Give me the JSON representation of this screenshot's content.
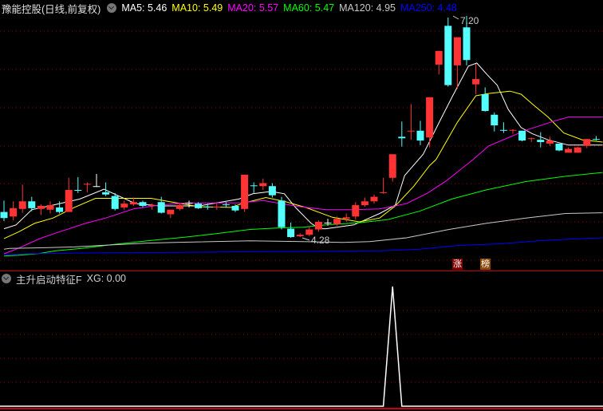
{
  "header": {
    "title": "豫能控股(日线,前复权)",
    "ma": [
      {
        "label": "MA5: 5.46",
        "color": "#ffffff"
      },
      {
        "label": "MA10: 5.49",
        "color": "#ffff00"
      },
      {
        "label": "MA20: 5.57",
        "color": "#ff00ff"
      },
      {
        "label": "MA60: 5.47",
        "color": "#00ff00"
      },
      {
        "label": "MA120: 4.95",
        "color": "#c8c8c8"
      },
      {
        "label": "MA250: 4.48",
        "color": "#0000ff"
      }
    ]
  },
  "annotations": {
    "high_label": "7.20",
    "low_label": "4.28"
  },
  "badges": [
    {
      "text": "涨",
      "color": "#800000",
      "index": 49
    },
    {
      "text": "榜",
      "color": "#8b4a0a",
      "index": 52
    }
  ],
  "indicator": {
    "title": "主升启动特征F",
    "value_label": "XG: 0.00"
  },
  "colors": {
    "up": "#ff3333",
    "down": "#54ffff",
    "doji": "#ffffff",
    "grid": "#8b0000",
    "divider": "#cc0000"
  },
  "chart_data": {
    "type": "candlestick",
    "ylim": [
      4.0,
      7.3
    ],
    "candles_ohlc": [
      [
        4.62,
        4.77,
        4.5,
        4.54
      ],
      [
        4.56,
        4.76,
        4.51,
        4.67
      ],
      [
        4.66,
        4.98,
        4.61,
        4.76
      ],
      [
        4.76,
        4.82,
        4.63,
        4.67
      ],
      [
        4.66,
        4.72,
        4.58,
        4.7
      ],
      [
        4.65,
        4.76,
        4.6,
        4.71
      ],
      [
        4.68,
        4.76,
        4.6,
        4.62
      ],
      [
        4.62,
        5.07,
        4.62,
        4.91
      ],
      [
        4.91,
        5.08,
        4.87,
        4.9
      ],
      [
        4.98,
        5.01,
        4.88,
        4.99
      ],
      [
        4.96,
        5.12,
        4.95,
        4.96
      ],
      [
        4.88,
        5.01,
        4.83,
        4.85
      ],
      [
        4.83,
        4.87,
        4.64,
        4.66
      ],
      [
        4.68,
        4.77,
        4.65,
        4.73
      ],
      [
        4.72,
        4.81,
        4.7,
        4.75
      ],
      [
        4.75,
        4.77,
        4.68,
        4.7
      ],
      [
        4.7,
        4.73,
        4.65,
        4.71
      ],
      [
        4.75,
        4.82,
        4.6,
        4.61
      ],
      [
        4.59,
        4.65,
        4.54,
        4.65
      ],
      [
        4.66,
        4.73,
        4.64,
        4.71
      ],
      [
        4.74,
        4.77,
        4.68,
        4.74
      ],
      [
        4.73,
        4.75,
        4.66,
        4.67
      ],
      [
        4.69,
        4.73,
        4.65,
        4.68
      ],
      [
        4.68,
        4.75,
        4.65,
        4.69
      ],
      [
        4.72,
        4.75,
        4.68,
        4.71
      ],
      [
        4.7,
        4.72,
        4.62,
        4.64
      ],
      [
        4.66,
        5.11,
        4.62,
        5.11
      ],
      [
        4.97,
        5.01,
        4.87,
        4.96
      ],
      [
        4.96,
        5.06,
        4.91,
        5.0
      ],
      [
        4.96,
        5.0,
        4.81,
        4.84
      ],
      [
        4.77,
        4.82,
        4.39,
        4.42
      ],
      [
        4.4,
        4.48,
        4.28,
        4.29
      ],
      [
        4.3,
        4.34,
        4.29,
        4.32
      ],
      [
        4.32,
        4.42,
        4.3,
        4.39
      ],
      [
        4.39,
        4.51,
        4.36,
        4.49
      ],
      [
        4.48,
        4.53,
        4.44,
        4.48
      ],
      [
        4.46,
        4.56,
        4.44,
        4.53
      ],
      [
        4.53,
        4.6,
        4.49,
        4.55
      ],
      [
        4.56,
        4.75,
        4.52,
        4.71
      ],
      [
        4.71,
        4.81,
        4.69,
        4.76
      ],
      [
        4.76,
        4.85,
        4.73,
        4.82
      ],
      [
        4.87,
        5.07,
        4.86,
        4.88
      ],
      [
        5.07,
        5.38,
        5.02,
        5.38
      ],
      [
        5.61,
        5.81,
        5.48,
        5.59
      ],
      [
        5.68,
        6.04,
        5.57,
        5.69
      ],
      [
        5.69,
        5.82,
        5.5,
        5.56
      ],
      [
        5.6,
        6.13,
        5.47,
        6.13
      ],
      [
        6.56,
        6.74,
        6.43,
        6.74
      ],
      [
        7.07,
        7.18,
        6.27,
        6.29
      ],
      [
        6.55,
        6.92,
        6.24,
        6.92
      ],
      [
        7.05,
        7.2,
        6.55,
        6.62
      ],
      [
        6.3,
        6.57,
        6.17,
        6.37
      ],
      [
        6.17,
        6.26,
        5.94,
        5.95
      ],
      [
        5.9,
        5.93,
        5.68,
        5.76
      ],
      [
        5.7,
        5.8,
        5.66,
        5.69
      ],
      [
        5.69,
        5.71,
        5.65,
        5.7
      ],
      [
        5.69,
        5.69,
        5.55,
        5.56
      ],
      [
        5.58,
        5.6,
        5.54,
        5.59
      ],
      [
        5.57,
        5.67,
        5.47,
        5.54
      ],
      [
        5.52,
        5.61,
        5.49,
        5.56
      ],
      [
        5.52,
        5.52,
        5.42,
        5.43
      ],
      [
        5.4,
        5.47,
        5.4,
        5.45
      ],
      [
        5.4,
        5.48,
        5.4,
        5.47
      ],
      [
        5.49,
        5.58,
        5.46,
        5.58
      ],
      [
        5.58,
        5.62,
        5.56,
        5.57
      ]
    ],
    "ma_lines": [
      {
        "name": "MA5",
        "color": "#ffffff",
        "points": [
          [
            0,
            4.4
          ],
          [
            1.3,
            4.45
          ],
          [
            3.0,
            4.65
          ],
          [
            5.3,
            4.71
          ],
          [
            8.2,
            4.79
          ],
          [
            10.8,
            4.92
          ],
          [
            14.2,
            4.73
          ],
          [
            16.8,
            4.7
          ],
          [
            21.1,
            4.7
          ],
          [
            25.4,
            4.79
          ],
          [
            26.9,
            4.86
          ],
          [
            28.9,
            4.89
          ],
          [
            30.3,
            4.86
          ],
          [
            31.5,
            4.68
          ],
          [
            33.2,
            4.47
          ],
          [
            34.1,
            4.4
          ],
          [
            34.8,
            4.4
          ],
          [
            37.8,
            4.45
          ],
          [
            40.6,
            4.6
          ],
          [
            42.3,
            4.71
          ],
          [
            43.3,
            5.1
          ],
          [
            45.3,
            5.38
          ],
          [
            47.2,
            5.84
          ],
          [
            48.5,
            6.15
          ],
          [
            50.2,
            6.54
          ],
          [
            51.1,
            6.58
          ],
          [
            52.2,
            6.43
          ],
          [
            53.3,
            6.29
          ],
          [
            54.5,
            5.97
          ],
          [
            55.9,
            5.73
          ],
          [
            57.1,
            5.65
          ],
          [
            58.8,
            5.57
          ],
          [
            61.0,
            5.5
          ],
          [
            64.7,
            5.5
          ]
        ]
      },
      {
        "name": "MA10",
        "color": "#ffff00",
        "points": [
          [
            0,
            4.27
          ],
          [
            1.6,
            4.36
          ],
          [
            3.3,
            4.47
          ],
          [
            5.3,
            4.54
          ],
          [
            7.6,
            4.68
          ],
          [
            9.9,
            4.8
          ],
          [
            15.9,
            4.8
          ],
          [
            17.7,
            4.76
          ],
          [
            21.1,
            4.69
          ],
          [
            24.6,
            4.68
          ],
          [
            25.7,
            4.73
          ],
          [
            28.3,
            4.81
          ],
          [
            30.3,
            4.76
          ],
          [
            32.6,
            4.68
          ],
          [
            35.5,
            4.55
          ],
          [
            38.4,
            4.49
          ],
          [
            40.6,
            4.54
          ],
          [
            42.3,
            4.7
          ],
          [
            44.3,
            4.96
          ],
          [
            46.0,
            5.23
          ],
          [
            46.7,
            5.31
          ],
          [
            49.0,
            5.8
          ],
          [
            51.0,
            6.15
          ],
          [
            52.4,
            6.18
          ],
          [
            54.7,
            6.21
          ],
          [
            55.9,
            6.17
          ],
          [
            57.3,
            6.02
          ],
          [
            58.8,
            5.87
          ],
          [
            60.5,
            5.66
          ],
          [
            62.5,
            5.57
          ],
          [
            64.7,
            5.54
          ]
        ]
      },
      {
        "name": "MA20",
        "color": "#ff00ff",
        "points": [
          [
            0,
            4.07
          ],
          [
            1.3,
            4.13
          ],
          [
            3.9,
            4.27
          ],
          [
            5.3,
            4.33
          ],
          [
            8.8,
            4.47
          ],
          [
            11.0,
            4.54
          ],
          [
            14.0,
            4.66
          ],
          [
            16.8,
            4.71
          ],
          [
            19.7,
            4.74
          ],
          [
            25.4,
            4.74
          ],
          [
            28.0,
            4.77
          ],
          [
            32.0,
            4.69
          ],
          [
            34.8,
            4.65
          ],
          [
            37.8,
            4.65
          ],
          [
            40.6,
            4.66
          ],
          [
            43.5,
            4.73
          ],
          [
            45.8,
            4.87
          ],
          [
            47.8,
            5.03
          ],
          [
            50.7,
            5.31
          ],
          [
            52.4,
            5.49
          ],
          [
            56.5,
            5.7
          ],
          [
            59.3,
            5.81
          ],
          [
            61.0,
            5.87
          ],
          [
            64.7,
            5.87
          ]
        ]
      },
      {
        "name": "MA60",
        "color": "#00ff00",
        "points": [
          [
            0,
            4.04
          ],
          [
            1.5,
            4.05
          ],
          [
            3.6,
            4.07
          ],
          [
            5.6,
            4.11
          ],
          [
            8.4,
            4.14
          ],
          [
            11.6,
            4.19
          ],
          [
            15.5,
            4.24
          ],
          [
            19.7,
            4.29
          ],
          [
            22.6,
            4.33
          ],
          [
            26.6,
            4.39
          ],
          [
            29.7,
            4.41
          ],
          [
            32.3,
            4.42
          ],
          [
            34.8,
            4.45
          ],
          [
            38.6,
            4.48
          ],
          [
            41.5,
            4.52
          ],
          [
            44.9,
            4.63
          ],
          [
            48.4,
            4.79
          ],
          [
            52.1,
            4.91
          ],
          [
            56.4,
            5.02
          ],
          [
            60.7,
            5.09
          ],
          [
            64.7,
            5.14
          ]
        ]
      },
      {
        "name": "MA120",
        "color": "#c8c8c8",
        "points": [
          [
            0,
            4.13
          ],
          [
            0.6,
            4.14
          ],
          [
            4.5,
            4.15
          ],
          [
            7.6,
            4.16
          ],
          [
            10.5,
            4.18
          ],
          [
            15.5,
            4.21
          ],
          [
            18.5,
            4.22
          ],
          [
            26.6,
            4.24
          ],
          [
            32.3,
            4.23
          ],
          [
            36.6,
            4.22
          ],
          [
            39.5,
            4.23
          ],
          [
            43.5,
            4.28
          ],
          [
            48.1,
            4.39
          ],
          [
            52.1,
            4.47
          ],
          [
            56.4,
            4.54
          ],
          [
            60.7,
            4.6
          ],
          [
            64.7,
            4.61
          ]
        ]
      },
      {
        "name": "MA250",
        "color": "#0000ff",
        "points": [
          [
            0,
            4.06
          ],
          [
            2.4,
            4.07
          ],
          [
            8.4,
            4.08
          ],
          [
            20.5,
            4.09
          ],
          [
            28.6,
            4.1
          ],
          [
            32,
            4.1
          ],
          [
            40.6,
            4.11
          ],
          [
            44.9,
            4.13
          ],
          [
            49.2,
            4.18
          ],
          [
            53.5,
            4.2
          ],
          [
            57.8,
            4.24
          ],
          [
            60.7,
            4.26
          ],
          [
            64.7,
            4.28
          ]
        ]
      }
    ],
    "high": {
      "index": 50,
      "value": 7.2
    },
    "low": {
      "index": 31,
      "value": 4.28
    },
    "indicator_series": {
      "name": "XG",
      "spike_index": 42,
      "spike_value": 1,
      "baseline": 0
    }
  }
}
